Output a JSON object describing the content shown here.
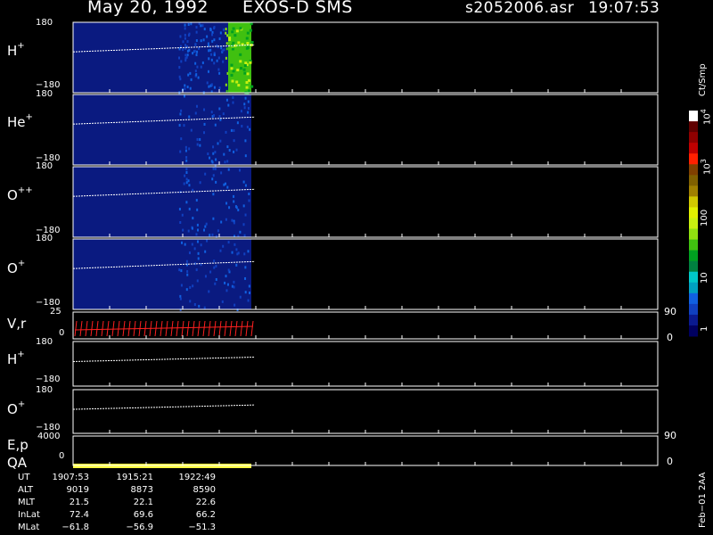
{
  "header": {
    "date": "May 20, 1992",
    "instrument": "EXOS-D SMS",
    "file": "s2052006.asr",
    "time": "19:07:53"
  },
  "panels": [
    {
      "label_main": "H",
      "label_sup": "+",
      "tick_top": "180",
      "tick_bottom": "−180"
    },
    {
      "label_main": "He",
      "label_sup": "+",
      "tick_top": "180",
      "tick_bottom": "−180"
    },
    {
      "label_main": "O",
      "label_sup": "++",
      "tick_top": "180",
      "tick_bottom": "−180"
    },
    {
      "label_main": "O",
      "label_sup": "+",
      "tick_top": "180",
      "tick_bottom": "−180"
    },
    {
      "label_main": "V,r",
      "label_sup": "",
      "tick_top": "25",
      "tick_bottom": "0",
      "rtick_top": "90",
      "rtick_bottom": "0"
    },
    {
      "label_main": "H",
      "label_sup": "+",
      "tick_top": "180",
      "tick_bottom": "−180"
    },
    {
      "label_main": "O",
      "label_sup": "+",
      "tick_top": "180",
      "tick_bottom": "−180"
    },
    {
      "label_main": "E,p",
      "label_sup": "",
      "tick_top": "4000",
      "tick_bottom": "0",
      "rtick_top": "90",
      "rtick_bottom": "0"
    },
    {
      "label_main": "QA",
      "label_sup": "",
      "tick_top": "",
      "tick_bottom": ""
    }
  ],
  "colorbar": {
    "unit": "Ct/Smp",
    "ticks": [
      "1",
      "10",
      "100",
      "10",
      "10"
    ],
    "tick_sups": [
      "",
      "",
      "",
      "3",
      "4"
    ],
    "colors": [
      "#000060",
      "#0a1a90",
      "#1040c0",
      "#1060e0",
      "#00a0c0",
      "#00c8c8",
      "#008040",
      "#00a020",
      "#40c010",
      "#90e010",
      "#c8f010",
      "#e0f000",
      "#d0c800",
      "#a08000",
      "#806000",
      "#804000",
      "#ff2000",
      "#c00000",
      "#900000",
      "#600000",
      "#ffffff"
    ]
  },
  "chart_data": {
    "type": "heatmap",
    "title": "May 20, 1992   EXOS-D SMS",
    "x_ticks_ut": [
      "1907:53",
      "1915:21",
      "1922:49"
    ],
    "data_extent_fraction_of_time_axis": 0.3,
    "panels": [
      {
        "name": "H+",
        "ylim": [
          -180,
          180
        ],
        "scale": "log",
        "dominant_levels": [
          "10",
          "100"
        ]
      },
      {
        "name": "He+",
        "ylim": [
          -180,
          180
        ]
      },
      {
        "name": "O++",
        "ylim": [
          -180,
          180
        ]
      },
      {
        "name": "O+",
        "ylim": [
          -180,
          180
        ]
      },
      {
        "name": "V,r",
        "ylim": [
          0,
          25
        ],
        "ylim_right": [
          0,
          90
        ]
      },
      {
        "name": "H+",
        "ylim": [
          -180,
          180
        ]
      },
      {
        "name": "O+",
        "ylim": [
          -180,
          180
        ]
      },
      {
        "name": "E,p",
        "ylim": [
          0,
          4000
        ],
        "ylim_right": [
          0,
          90
        ]
      }
    ],
    "colorbar_range": [
      "1",
      "10^4"
    ]
  },
  "ephemeris": {
    "rows": [
      {
        "label": "UT",
        "values": [
          "1907:53",
          "1915:21",
          "1922:49"
        ]
      },
      {
        "label": "ALT",
        "values": [
          "9019",
          "8873",
          "8590"
        ]
      },
      {
        "label": "MLT",
        "values": [
          "21.5",
          "22.1",
          "22.6"
        ]
      },
      {
        "label": "InLat",
        "values": [
          "72.4",
          "69.6",
          "66.2"
        ]
      },
      {
        "label": "MLat",
        "values": [
          "−61.8",
          "−56.9",
          "−51.3"
        ]
      }
    ]
  },
  "stamp": "Feb−01 2AA",
  "colors": {
    "background": "#000000",
    "spectro_fill": "#0a1a80",
    "trace": "#ffffff",
    "vr": "#ff2020",
    "qa": "#ffff40"
  }
}
